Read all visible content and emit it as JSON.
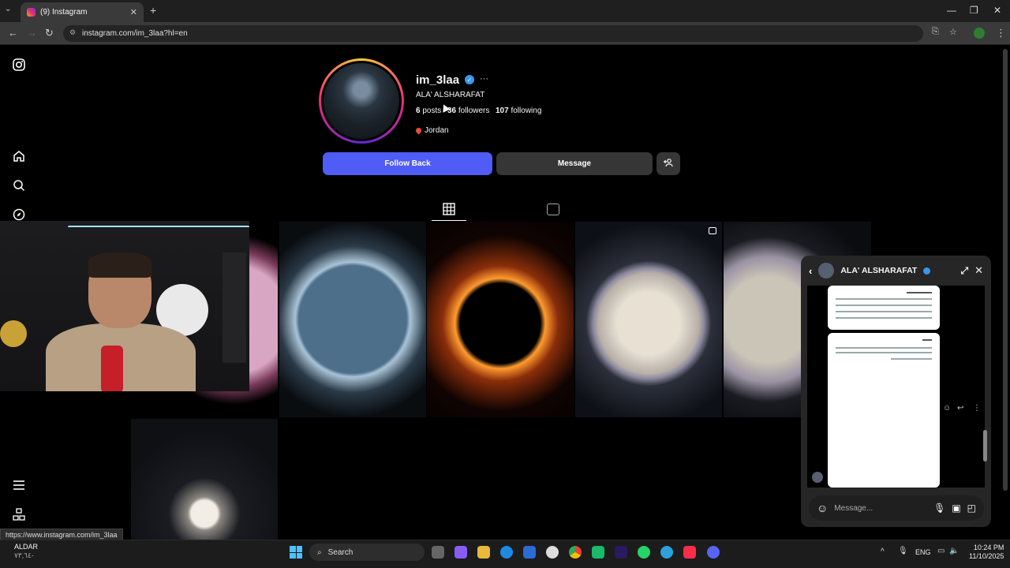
{
  "browser": {
    "tab_title": "(9) Instagram",
    "url": "instagram.com/im_3laa?hl=en",
    "status_url": "https://www.instagram.com/im_3laa"
  },
  "profile": {
    "username": "im_3laa",
    "full_name": "ALA' ALSHARAFAT",
    "posts_count": "6",
    "posts_label": "posts",
    "followers_count": "36",
    "followers_label": "followers",
    "following_count": "107",
    "following_label": "following",
    "location": "Jordan",
    "follow_back_label": "Follow Back",
    "message_label": "Message",
    "more_label": "···"
  },
  "chat": {
    "name": "ALA' ALSHARAFAT",
    "input_placeholder": "Message..."
  },
  "taskbar": {
    "search_label": "Search",
    "weather_title": "ALDAR",
    "weather_value": "٧٣,٦٤-",
    "lang": "ENG",
    "time": "10:24 PM",
    "date": "11/10/2025"
  },
  "colors": {
    "follow_button": "#4f5cf5",
    "verified": "#3897f0"
  }
}
